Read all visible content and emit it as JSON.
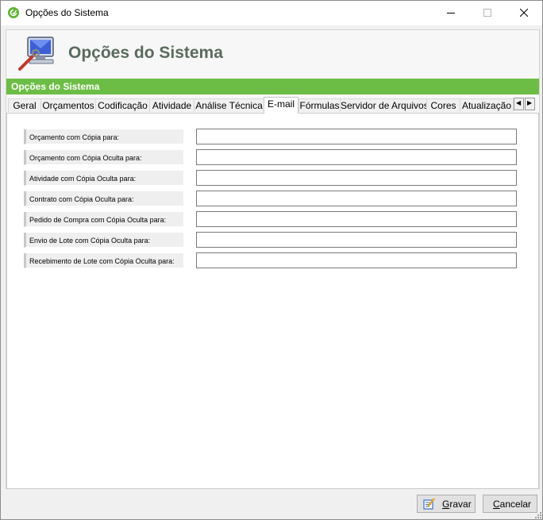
{
  "window": {
    "title": "Opções do Sistema"
  },
  "header": {
    "title": "Opções do Sistema"
  },
  "section": {
    "title": "Opções do Sistema"
  },
  "tabs": [
    {
      "label": "Geral"
    },
    {
      "label": "Orçamentos"
    },
    {
      "label": "Codificação"
    },
    {
      "label": "Atividade"
    },
    {
      "label": "Análise Técnica"
    },
    {
      "label": "E-mail",
      "active": true
    },
    {
      "label": "Fórmulas"
    },
    {
      "label": "Servidor de Arquivos"
    },
    {
      "label": "Cores"
    },
    {
      "label": "Atualização"
    }
  ],
  "fields": [
    {
      "label": "Orçamento com Cópia para:",
      "value": ""
    },
    {
      "label": "Orçamento com Cópia Oculta para:",
      "value": ""
    },
    {
      "label": "Atividade com Cópia Oculta para:",
      "value": ""
    },
    {
      "label": "Contrato com Cópia Oculta para:",
      "value": ""
    },
    {
      "label": "Pedido de Compra com Cópia Oculta para:",
      "value": ""
    },
    {
      "label": "Envio de Lote com Cópia Oculta para:",
      "value": ""
    },
    {
      "label": "Recebimento de Lote com Cópia Oculta para:",
      "value": ""
    }
  ],
  "buttons": {
    "save": {
      "accel": "G",
      "rest": "ravar"
    },
    "cancel": {
      "accel": "C",
      "rest": "ancelar"
    }
  },
  "colors": {
    "accent_green": "#6cbd45",
    "header_title": "#5a6b5e"
  },
  "icons": [
    "app-logo-icon",
    "minimize-icon",
    "maximize-icon",
    "close-icon",
    "system-options-icon",
    "tab-scroll-left-icon",
    "tab-scroll-right-icon",
    "save-icon",
    "resize-grip-icon"
  ]
}
